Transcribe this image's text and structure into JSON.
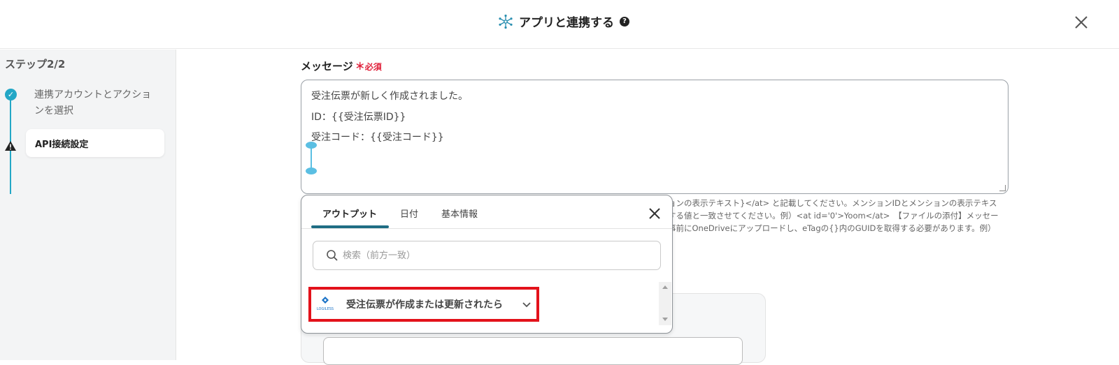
{
  "header": {
    "title": "アプリと連携する",
    "help_icon": "?",
    "app_icon": "network-icon",
    "close_icon": "close-icon"
  },
  "sidebar": {
    "step_label": "ステップ2/2",
    "steps": [
      {
        "label": "連携アカウントとアクションを選択",
        "status": "done",
        "icon": "check-icon"
      },
      {
        "label": "API接続設定",
        "status": "warning",
        "icon": "warning-icon"
      }
    ]
  },
  "field": {
    "label": "メッセージ",
    "required_mark": "＊",
    "required_text": "必須",
    "lines": [
      "受注伝票が新しく作成されました。",
      "ID：{{受注伝票ID}}",
      "受注コード：{{受注コード}}"
    ]
  },
  "hint": {
    "lines": [
      "ョンの表示テキスト}</at> と記載してください。メンションIDとメンションの表示テキス",
      "する値と一致させてください。例）<at id='0'>Yoom</at>　【ファイルの添付】メッセー",
      "事前にOneDriveにアップロードし、eTagの{}内のGUIDを取得する必要があります。例）"
    ]
  },
  "popup": {
    "tabs": [
      {
        "label": "アウトプット",
        "active": true
      },
      {
        "label": "日付",
        "active": false
      },
      {
        "label": "基本情報",
        "active": false
      }
    ],
    "search_placeholder": "検索（前方一致）",
    "items": [
      {
        "label": "受注伝票が作成または更新されたら",
        "logo": "logiless-logo-icon",
        "logo_text": "LOGILESS"
      }
    ]
  },
  "colors": {
    "accent": "#23a7c6",
    "tab_underline": "#1f6d84",
    "required": "#e0203a",
    "highlight_border": "#e3121b"
  }
}
